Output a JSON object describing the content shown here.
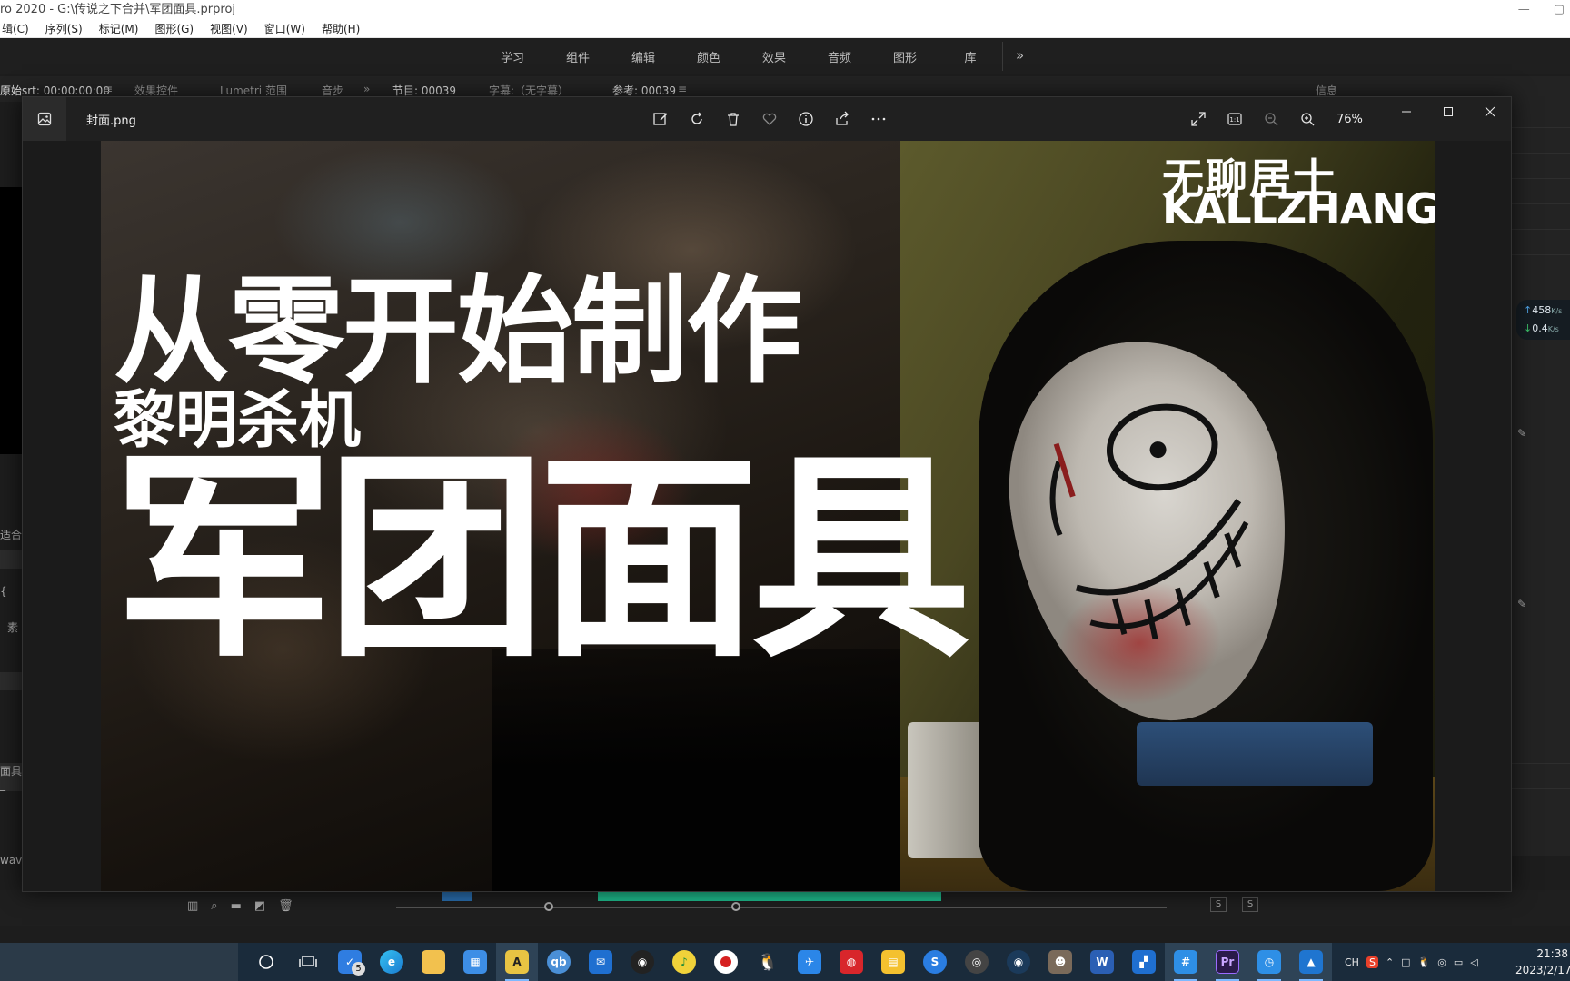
{
  "premiere": {
    "window_title": "ro 2020 - G:\\传说之下合并\\军团面具.prproj",
    "menu": [
      "辑(C)",
      "序列(S)",
      "标记(M)",
      "图形(G)",
      "视图(V)",
      "窗口(W)",
      "帮助(H)"
    ],
    "workspaces": [
      "学习",
      "组件",
      "编辑",
      "颜色",
      "效果",
      "音频",
      "图形",
      "库"
    ],
    "panels": {
      "source": "原始srt: 00:00:00:00",
      "effect_controls": "效果控件",
      "lumetri": "Lumetri 范围",
      "audio": "音步",
      "program": "节目: 00039",
      "captions": "字幕:（无字幕）",
      "reference": "参考: 00039",
      "info": "信息"
    },
    "left_labels": {
      "fit": "适合",
      "material": "素",
      "clip": "面具_",
      "wav": "wav"
    },
    "track_toggles": [
      "S",
      "S"
    ]
  },
  "net_speed": {
    "up_value": "458",
    "up_unit": "K/s",
    "down_value": "0.4",
    "down_unit": "K/s"
  },
  "viewer": {
    "filename": "封面.png",
    "zoom": "76%",
    "tool_icons": [
      "edit-image-icon",
      "rotate-icon",
      "delete-icon",
      "favorite-icon",
      "info-icon",
      "share-icon",
      "more-icon"
    ]
  },
  "cover": {
    "line1": "从零开始制作",
    "line2": "黎明杀机",
    "line3": "军团面具",
    "brand_cn": "无聊居士",
    "brand_en": "KALLZHANG"
  },
  "taskbar": {
    "badge": "5",
    "ime": "CH",
    "time": "21:38",
    "date": "2023/2/17"
  }
}
